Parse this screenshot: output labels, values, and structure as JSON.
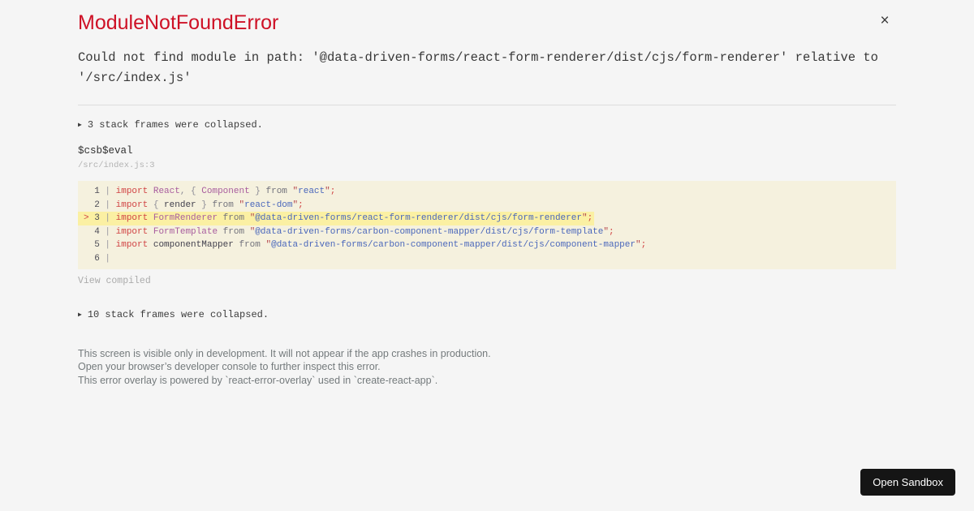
{
  "overlay": {
    "title": "ModuleNotFoundError",
    "close_label": "×",
    "message": "Could not find module in path: '@data-driven-forms/react-form-renderer/dist/cjs/form-renderer' relative to '/src/index.js'",
    "collapse_arrow": "▶",
    "stack_collapsed_top": "3 stack frames were collapsed.",
    "frame_function": "$csb$eval",
    "frame_location": "/src/index.js:3",
    "view_compiled_label": "View compiled",
    "stack_collapsed_bottom": "10 stack frames were collapsed.",
    "footer": {
      "lines": [
        "This screen is visible only in development. It will not appear if the app crashes in production.",
        "Open your browser’s developer console to further inspect this error.",
        "This error overlay is powered by `react-error-overlay` used in `create-react-app`."
      ]
    }
  },
  "code": {
    "lines": [
      {
        "marker": " ",
        "number": "1",
        "highlighted": false,
        "tokens": [
          {
            "t": "k",
            "v": "import"
          },
          {
            "t": "t",
            "v": " "
          },
          {
            "t": "i",
            "v": "React"
          },
          {
            "t": "p",
            "v": ", { "
          },
          {
            "t": "i",
            "v": "Component"
          },
          {
            "t": "p",
            "v": " } "
          },
          {
            "t": "f",
            "v": "from"
          },
          {
            "t": "t",
            "v": " "
          },
          {
            "t": "q",
            "v": "\""
          },
          {
            "t": "s",
            "v": "react"
          },
          {
            "t": "q",
            "v": "\""
          },
          {
            "t": "m",
            "v": ";"
          }
        ]
      },
      {
        "marker": " ",
        "number": "2",
        "highlighted": false,
        "tokens": [
          {
            "t": "k",
            "v": "import"
          },
          {
            "t": "p",
            "v": " { "
          },
          {
            "t": "t",
            "v": "render"
          },
          {
            "t": "p",
            "v": " } "
          },
          {
            "t": "f",
            "v": "from"
          },
          {
            "t": "t",
            "v": " "
          },
          {
            "t": "q",
            "v": "\""
          },
          {
            "t": "s",
            "v": "react-dom"
          },
          {
            "t": "q",
            "v": "\""
          },
          {
            "t": "m",
            "v": ";"
          }
        ]
      },
      {
        "marker": ">",
        "number": "3",
        "highlighted": true,
        "tokens": [
          {
            "t": "k",
            "v": "import"
          },
          {
            "t": "t",
            "v": " "
          },
          {
            "t": "i",
            "v": "FormRenderer"
          },
          {
            "t": "t",
            "v": " "
          },
          {
            "t": "f",
            "v": "from"
          },
          {
            "t": "t",
            "v": " "
          },
          {
            "t": "q",
            "v": "\""
          },
          {
            "t": "s",
            "v": "@data-driven-forms/react-form-renderer/dist/cjs/form-renderer"
          },
          {
            "t": "q",
            "v": "\""
          },
          {
            "t": "m",
            "v": ";"
          }
        ]
      },
      {
        "marker": " ",
        "number": "4",
        "highlighted": false,
        "tokens": [
          {
            "t": "k",
            "v": "import"
          },
          {
            "t": "t",
            "v": " "
          },
          {
            "t": "i",
            "v": "FormTemplate"
          },
          {
            "t": "t",
            "v": " "
          },
          {
            "t": "f",
            "v": "from"
          },
          {
            "t": "t",
            "v": " "
          },
          {
            "t": "q",
            "v": "\""
          },
          {
            "t": "s",
            "v": "@data-driven-forms/carbon-component-mapper/dist/cjs/form-template"
          },
          {
            "t": "q",
            "v": "\""
          },
          {
            "t": "m",
            "v": ";"
          }
        ]
      },
      {
        "marker": " ",
        "number": "5",
        "highlighted": false,
        "tokens": [
          {
            "t": "k",
            "v": "import"
          },
          {
            "t": "t",
            "v": " "
          },
          {
            "t": "t",
            "v": "componentMapper"
          },
          {
            "t": "t",
            "v": " "
          },
          {
            "t": "f",
            "v": "from"
          },
          {
            "t": "t",
            "v": " "
          },
          {
            "t": "q",
            "v": "\""
          },
          {
            "t": "s",
            "v": "@data-driven-forms/carbon-component-mapper/dist/cjs/component-mapper"
          },
          {
            "t": "q",
            "v": "\""
          },
          {
            "t": "m",
            "v": ";"
          }
        ]
      },
      {
        "marker": " ",
        "number": "6",
        "highlighted": false,
        "tokens": []
      }
    ]
  },
  "sandbox": {
    "open_label": "Open Sandbox"
  },
  "colors": {
    "page-bg": "#f5f5f5",
    "title": "#ce1126",
    "code-bg": "#f5f1de",
    "highlight": "#fbf0a3",
    "keyword": "#d04343",
    "identifier": "#a85d9e",
    "string": "#4a67bb",
    "button-bg": "#151515"
  }
}
